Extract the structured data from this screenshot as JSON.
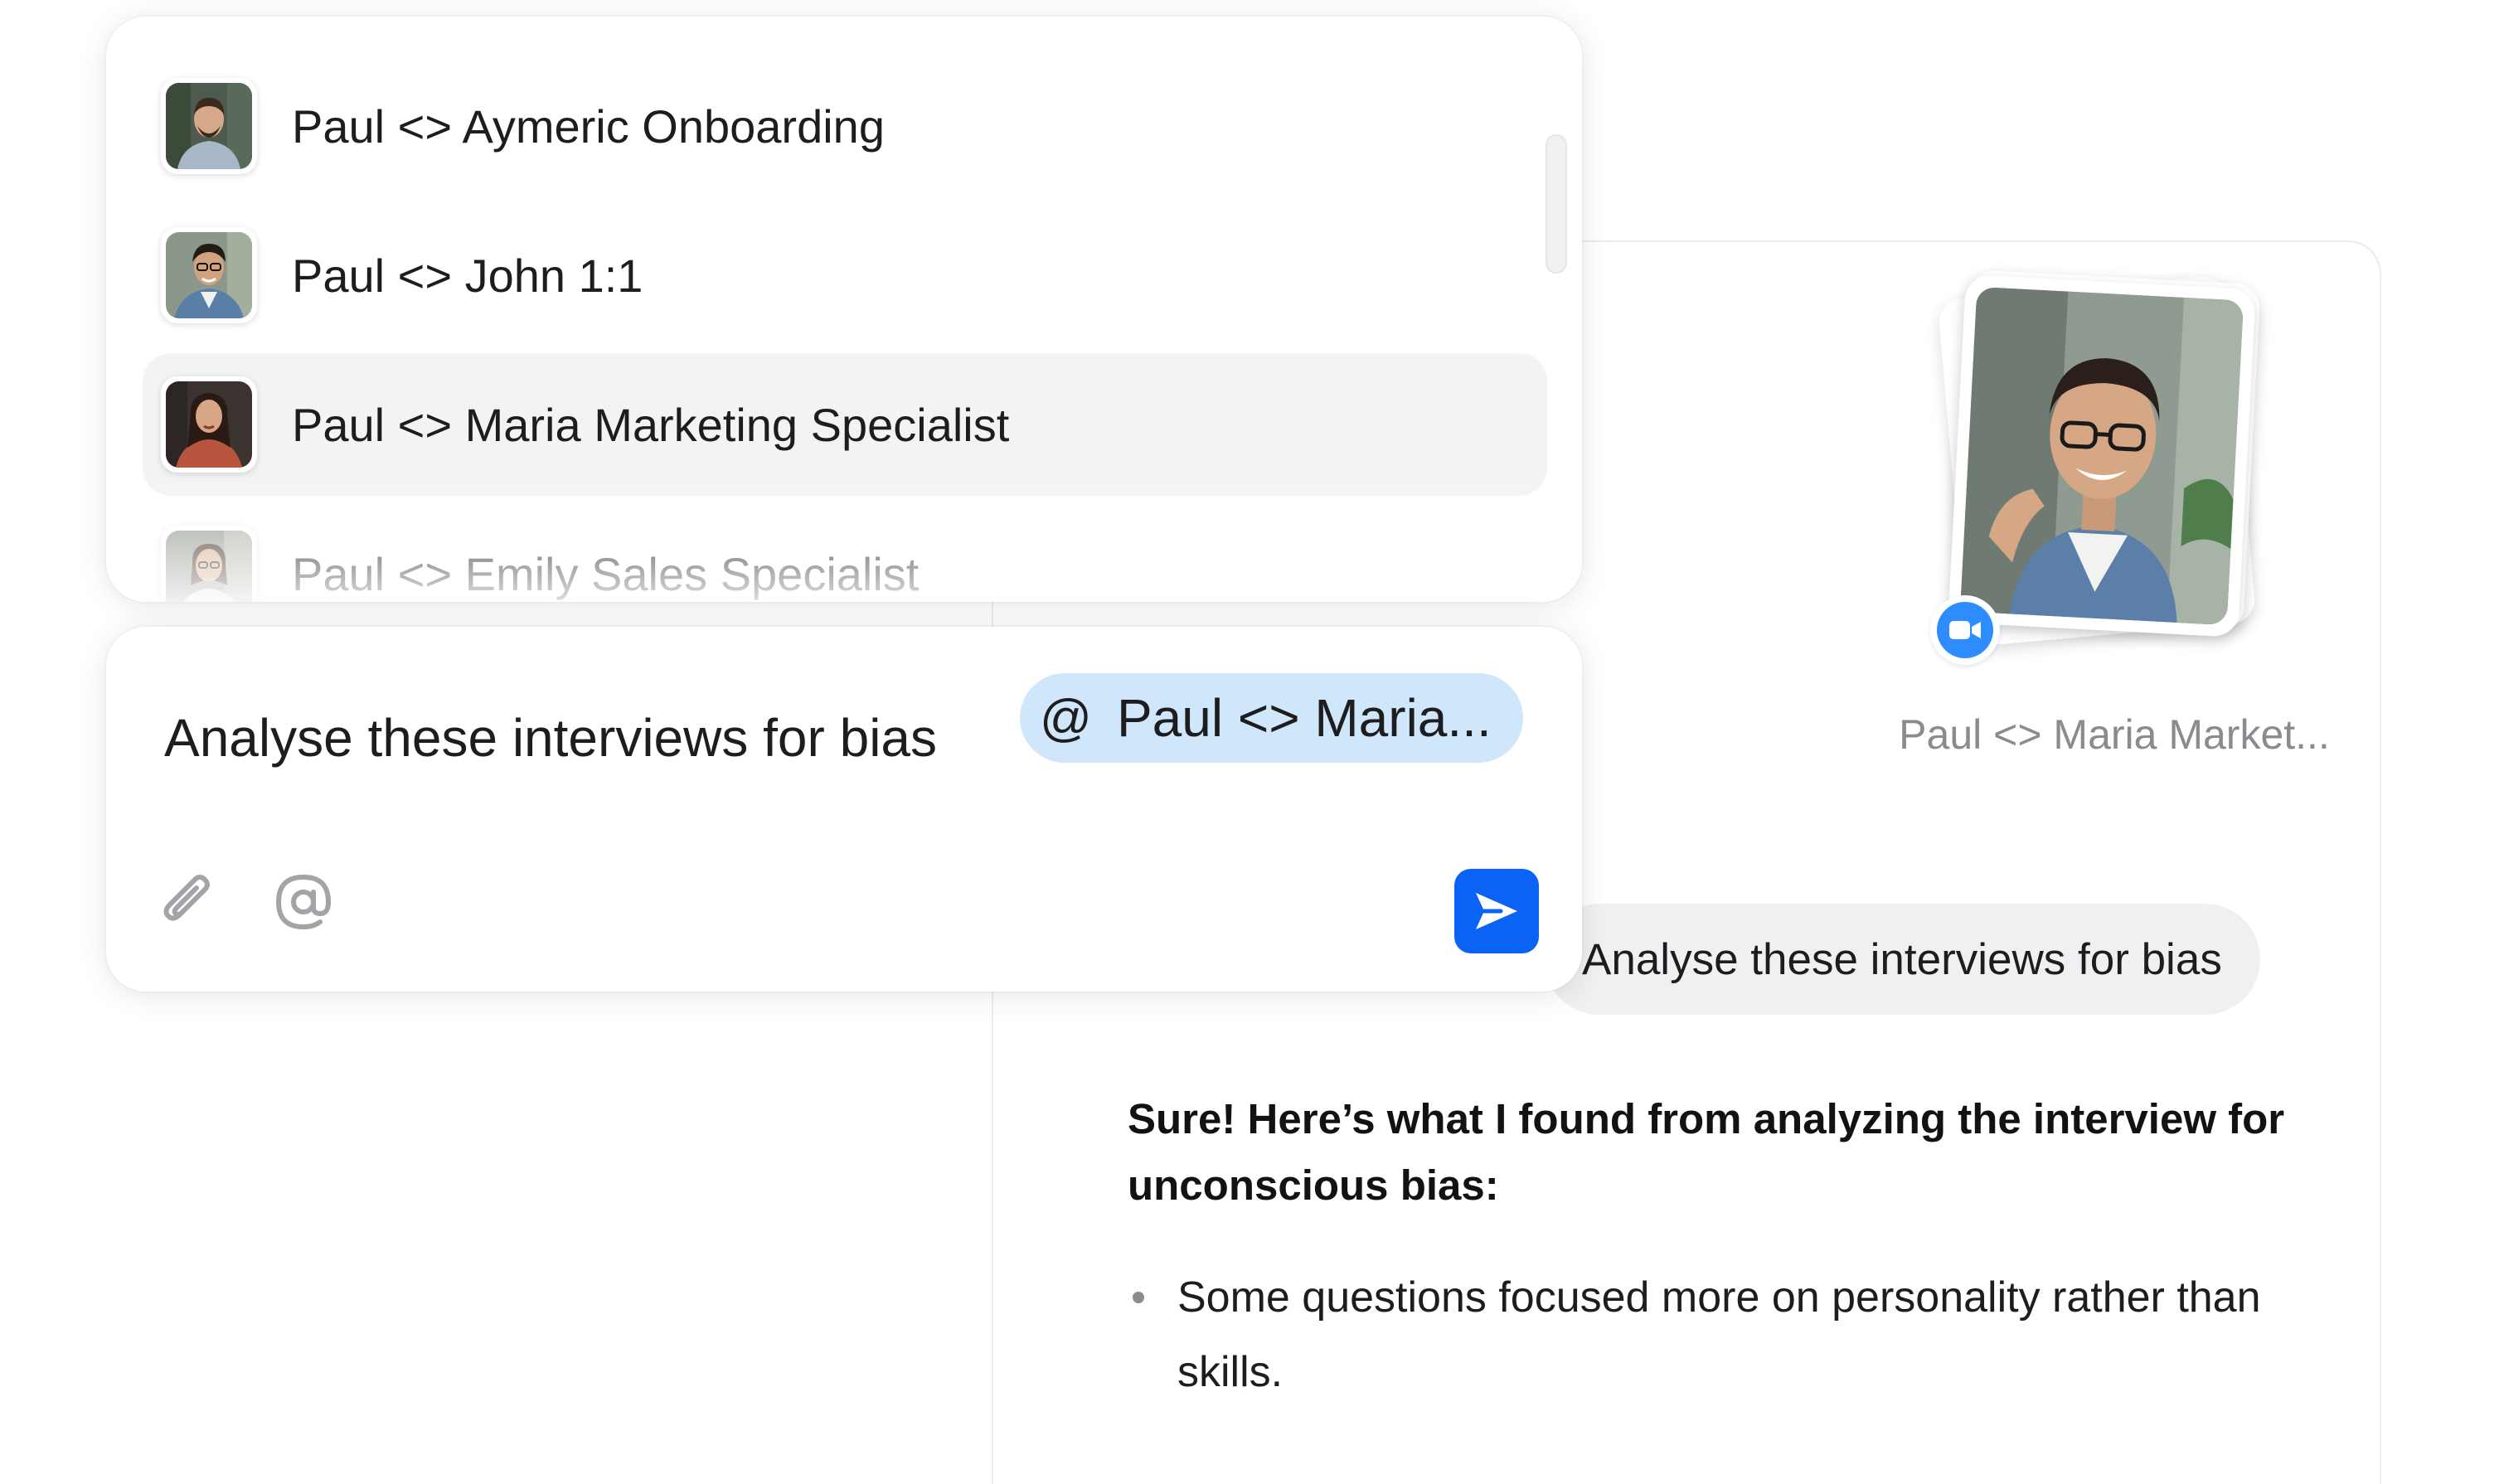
{
  "mention_list": {
    "items": [
      {
        "label": "Paul <> Aymeric Onboarding",
        "selected": false
      },
      {
        "label": "Paul <> John 1:1",
        "selected": false
      },
      {
        "label": "Paul <> Maria Marketing Specialist",
        "selected": true
      },
      {
        "label": "Paul <> Emily Sales Specialist",
        "selected": false
      }
    ]
  },
  "composer": {
    "text": "Analyse these interviews for bias",
    "mention_chip": {
      "symbol": "@",
      "label": "Paul <> Maria..."
    },
    "icons": [
      "paperclip-icon",
      "at-icon",
      "send-icon"
    ],
    "send_color": "#0b63f6"
  },
  "chat": {
    "attachment": {
      "caption": "Paul <> Maria Market...",
      "badge_icon": "video-camera-icon",
      "badge_color": "#2d8cff"
    },
    "user_message": "Analyse these interviews for bias",
    "assistant": {
      "heading": "Sure! Here’s what I found from analyzing the interview for unconscious bias:",
      "bullets": [
        "Some questions focused more on personality rather than skills."
      ]
    }
  },
  "colors": {
    "chip_background": "#cfe6fb",
    "selected_row": "#f3f3f4",
    "user_bubble": "#eef0f2"
  }
}
